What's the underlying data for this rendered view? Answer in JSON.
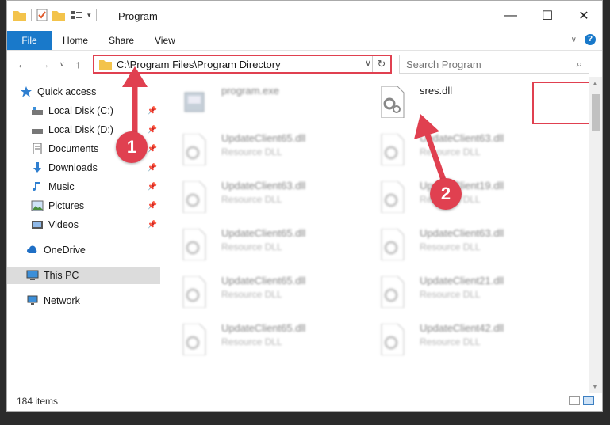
{
  "window": {
    "title": "Program"
  },
  "ribbon": {
    "tabs": [
      "File",
      "Home",
      "Share",
      "View"
    ],
    "help_label": "?"
  },
  "address": {
    "path": "C:\\Program Files\\Program Directory"
  },
  "search": {
    "placeholder": "Search Program"
  },
  "sidebar": {
    "items": [
      {
        "label": "Quick access",
        "icon": "star-icon"
      },
      {
        "label": "Local Disk (C:)",
        "icon": "drive-icon"
      },
      {
        "label": "Local Disk (D:)",
        "icon": "drive-icon"
      },
      {
        "label": "Documents",
        "icon": "documents-icon"
      },
      {
        "label": "Downloads",
        "icon": "download-icon"
      },
      {
        "label": "Music",
        "icon": "music-icon"
      },
      {
        "label": "Pictures",
        "icon": "pictures-icon"
      },
      {
        "label": "Videos",
        "icon": "videos-icon"
      },
      {
        "label": "OneDrive",
        "icon": "cloud-icon"
      },
      {
        "label": "This PC",
        "icon": "computer-icon"
      },
      {
        "label": "Network",
        "icon": "network-icon"
      }
    ]
  },
  "files": [
    {
      "name": "program.exe",
      "type": ""
    },
    {
      "name": "sres.dll",
      "type": ""
    },
    {
      "name": "UpdateClient65.dll",
      "type": "Resource DLL"
    },
    {
      "name": "UpdateClient63.dll",
      "type": "Resource DLL"
    },
    {
      "name": "UpdateClient63.dll",
      "type": "Resource DLL"
    },
    {
      "name": "UpdateClient19.dll",
      "type": "Resource DLL"
    },
    {
      "name": "UpdateClient65.dll",
      "type": "Resource DLL"
    },
    {
      "name": "UpdateClient63.dll",
      "type": "Resource DLL"
    },
    {
      "name": "UpdateClient65.dll",
      "type": "Resource DLL"
    },
    {
      "name": "UpdateClient21.dll",
      "type": "Resource DLL"
    },
    {
      "name": "UpdateClient65.dll",
      "type": "Resource DLL"
    },
    {
      "name": "UpdateClient42.dll",
      "type": "Resource DLL"
    }
  ],
  "status": {
    "count": "184 items"
  },
  "annotations": {
    "step1": "1",
    "step2": "2"
  },
  "colors": {
    "accent": "#1979ca",
    "highlight": "#e04050"
  }
}
